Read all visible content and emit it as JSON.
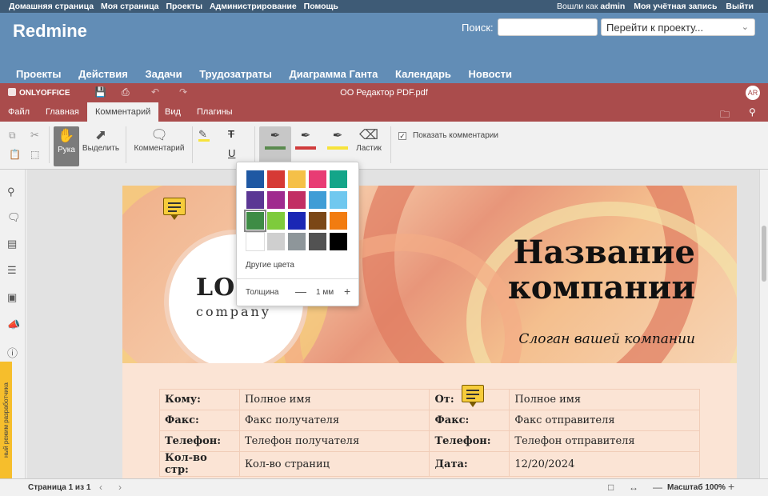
{
  "redmine": {
    "top_left": [
      "Домашняя страница",
      "Моя страница",
      "Проекты",
      "Администрирование",
      "Помощь"
    ],
    "logged_as": "Вошли как",
    "user": "admin",
    "account": "Моя учётная запись",
    "logout": "Выйти",
    "title": "Redmine",
    "search_label": "Поиск:",
    "search_value": "",
    "project_jump": "Перейти к проекту...",
    "menu": [
      "Проекты",
      "Действия",
      "Задачи",
      "Трудозатраты",
      "Диаграмма Ганта",
      "Календарь",
      "Новости"
    ]
  },
  "editor": {
    "brand": "ONLYOFFICE",
    "file_name": "ОО Редактор PDF.pdf",
    "avatar": "AR",
    "tabs": [
      "Файл",
      "Главная",
      "Комментарий",
      "Вид",
      "Плагины"
    ],
    "active_tab": "Комментарий",
    "toolbar": {
      "hand": "Рука",
      "select": "Выделить",
      "comment": "Комментарий",
      "eraser": "Ластик",
      "show_comments": "Показать комментарии",
      "show_comments_checked": true,
      "pen_colors": [
        "#5a8a4f",
        "#d03b3b",
        "#f7e33b"
      ]
    },
    "dev_mode": "ный режим разработчика"
  },
  "palette": {
    "colors": [
      "#1f58a3",
      "#d63a35",
      "#f5c048",
      "#e83c74",
      "#14a589",
      "#5b3794",
      "#a02a8e",
      "#c22e63",
      "#3f9dd6",
      "#70c8ef",
      "#3e8c45",
      "#7ecb3c",
      "#1a27b5",
      "#7b4716",
      "#f27c10",
      "#ffffff",
      "#cfcfcf",
      "#8e969a",
      "#525252",
      "#000000"
    ],
    "selected_index": 10,
    "other_colors": "Другие цвета",
    "thickness_label": "Толщина",
    "thickness_value": "1 мм"
  },
  "document": {
    "logo_main": "LO",
    "logo_sub": "company",
    "company_name_1": "Название",
    "company_name_2": "компании",
    "slogan": "Слоган вашей компании",
    "rows": [
      {
        "k1": "Кому:",
        "v1": "Полное имя",
        "k2": "От:",
        "v2": "Полное имя"
      },
      {
        "k1": "Факс:",
        "v1": "Факс получателя",
        "k2": "Факс:",
        "v2": "Факс отправителя"
      },
      {
        "k1": "Телефон:",
        "v1": "Телефон получателя",
        "k2": "Телефон:",
        "v2": "Телефон отправителя"
      },
      {
        "k1": "Кол-во стр:",
        "v1": "Кол-во страниц",
        "k2": "Дата:",
        "v2": "12/20/2024"
      }
    ]
  },
  "status": {
    "page": "Страница 1 из 1",
    "zoom": "Масштаб 100%"
  }
}
